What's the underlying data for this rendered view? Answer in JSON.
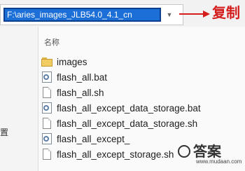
{
  "address_bar": {
    "path": "F:\\aries_images_JLB54.0_4.1_cn",
    "dropdown_icon": "chevron-down-icon"
  },
  "annotation": {
    "label": "复制",
    "color": "#d41d1d",
    "arrow_icon": "arrow-right-icon"
  },
  "left_pane": {
    "partial_label": "置"
  },
  "file_pane": {
    "column_header": "名称",
    "files": [
      {
        "name": "images",
        "icon": "folder-icon"
      },
      {
        "name": "flash_all.bat",
        "icon": "gear-file-icon"
      },
      {
        "name": "flash_all.sh",
        "icon": "document-icon"
      },
      {
        "name": "flash_all_except_data_storage.bat",
        "icon": "gear-file-icon"
      },
      {
        "name": "flash_all_except_data_storage.sh",
        "icon": "document-icon"
      },
      {
        "name": "flash_all_except_",
        "icon": "gear-file-icon"
      },
      {
        "name": "flash_all_except_storage.sh",
        "icon": "document-icon"
      }
    ]
  },
  "watermark": {
    "text": "答案",
    "url": "www.mudaan.com"
  },
  "colors": {
    "selection": "#1c6fd6",
    "accent_red": "#d41d1d"
  }
}
